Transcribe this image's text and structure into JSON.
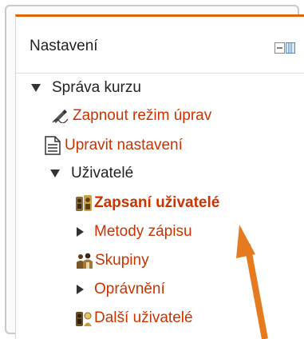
{
  "block": {
    "title": "Nastavení",
    "dock_icon": "dock-icon"
  },
  "tree": {
    "course_admin": {
      "label": "Správa kurzu",
      "icon": "triangle-down-icon"
    },
    "edit_mode": {
      "label": "Zapnout režim úprav",
      "icon": "pencil-icon"
    },
    "edit_settings": {
      "label": "Upravit nastavení",
      "icon": "document-icon"
    },
    "users": {
      "label": "Uživatelé",
      "icon": "triangle-down-icon"
    },
    "enrolled_users": {
      "label": "Zapsaní uživatelé",
      "icon": "enrolled-users-icon"
    },
    "enrol_methods": {
      "label": "Metody zápisu",
      "icon": "triangle-right-icon"
    },
    "groups": {
      "label": "Skupiny",
      "icon": "groups-icon"
    },
    "permissions": {
      "label": "Oprávnění",
      "icon": "triangle-right-icon"
    },
    "other_users": {
      "label": "Další uživatelé",
      "icon": "other-users-icon"
    }
  },
  "colors": {
    "accent": "#e0640a",
    "link": "#cc3300",
    "annotation_arrow": "#e57a1e"
  }
}
